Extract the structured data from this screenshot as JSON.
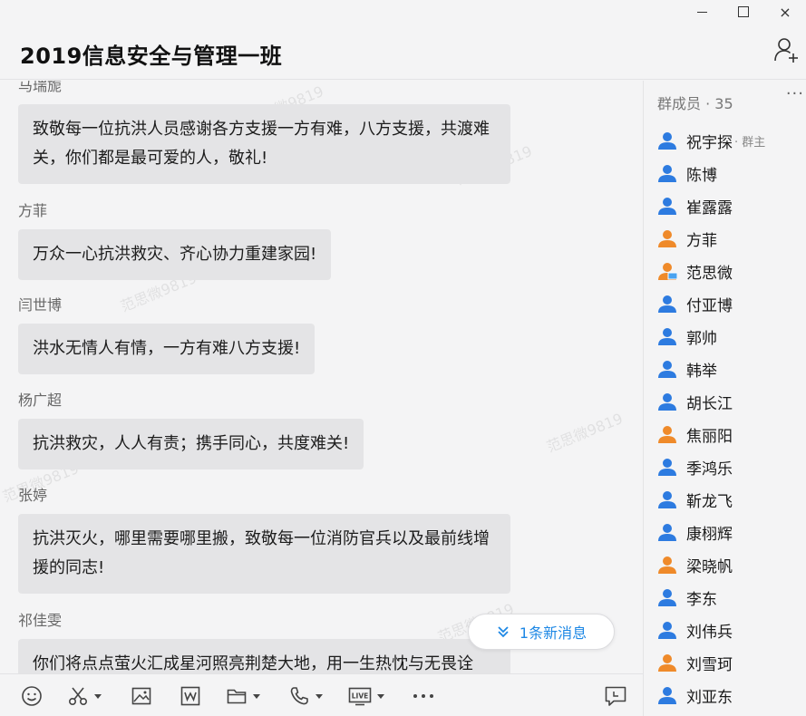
{
  "window": {
    "minimize": "",
    "maximize": "",
    "close": "×"
  },
  "header": {
    "title": "2019信息安全与管理一班"
  },
  "chat": {
    "messages": [
      {
        "sender": "马瑞旎",
        "text": "致敬每一位抗洪人员感谢各方支援一方有难，八方支援，共渡难关，你们都是最可爱的人，敬礼!"
      },
      {
        "sender": "方菲",
        "text": "万众一心抗洪救灾、齐心协力重建家园!"
      },
      {
        "sender": "闫世博",
        "text": "洪水无情人有情，一方有难八方支援!"
      },
      {
        "sender": "杨广超",
        "text": "抗洪救灾，人人有责；携手同心，共度难关!"
      },
      {
        "sender": "张婷",
        "text": "抗洪灭火，哪里需要哪里搬，致敬每一位消防官兵以及最前线增援的同志!"
      },
      {
        "sender": "祁佳雯",
        "text": "你们将点点萤火汇成星河照亮荆楚大地，用一生热忱与无畏诠"
      }
    ],
    "watermark": "范思微9819",
    "new_message_label": "1条新消息"
  },
  "sidebar": {
    "header": "群成员 · 35",
    "more": "···",
    "members": [
      {
        "name": "祝宇探",
        "role": "· 群主",
        "color": "#2d7be0"
      },
      {
        "name": "陈博",
        "role": "",
        "color": "#2d7be0"
      },
      {
        "name": "崔露露",
        "role": "",
        "color": "#2d7be0"
      },
      {
        "name": "方菲",
        "role": "",
        "color": "#ef8a2a"
      },
      {
        "name": "范思微",
        "role": "",
        "color": "#ef8a2a"
      },
      {
        "name": "付亚博",
        "role": "",
        "color": "#2d7be0"
      },
      {
        "name": "郭帅",
        "role": "",
        "color": "#2d7be0"
      },
      {
        "name": "韩举",
        "role": "",
        "color": "#2d7be0"
      },
      {
        "name": "胡长江",
        "role": "",
        "color": "#2d7be0"
      },
      {
        "name": "焦丽阳",
        "role": "",
        "color": "#ef8a2a"
      },
      {
        "name": "季鸿乐",
        "role": "",
        "color": "#2d7be0"
      },
      {
        "name": "靳龙飞",
        "role": "",
        "color": "#2d7be0"
      },
      {
        "name": "康栩辉",
        "role": "",
        "color": "#2d7be0"
      },
      {
        "name": "梁晓帆",
        "role": "",
        "color": "#ef8a2a"
      },
      {
        "name": "李东",
        "role": "",
        "color": "#2d7be0"
      },
      {
        "name": "刘伟兵",
        "role": "",
        "color": "#2d7be0"
      },
      {
        "name": "刘雪珂",
        "role": "",
        "color": "#ef8a2a"
      },
      {
        "name": "刘亚东",
        "role": "",
        "color": "#2d7be0"
      }
    ]
  },
  "toolbar": {
    "icons": [
      "emoji-icon",
      "scissors-icon",
      "image-icon",
      "word-doc-icon",
      "folder-icon",
      "phone-icon",
      "live-icon",
      "more-icon",
      "chat-history-icon"
    ]
  }
}
